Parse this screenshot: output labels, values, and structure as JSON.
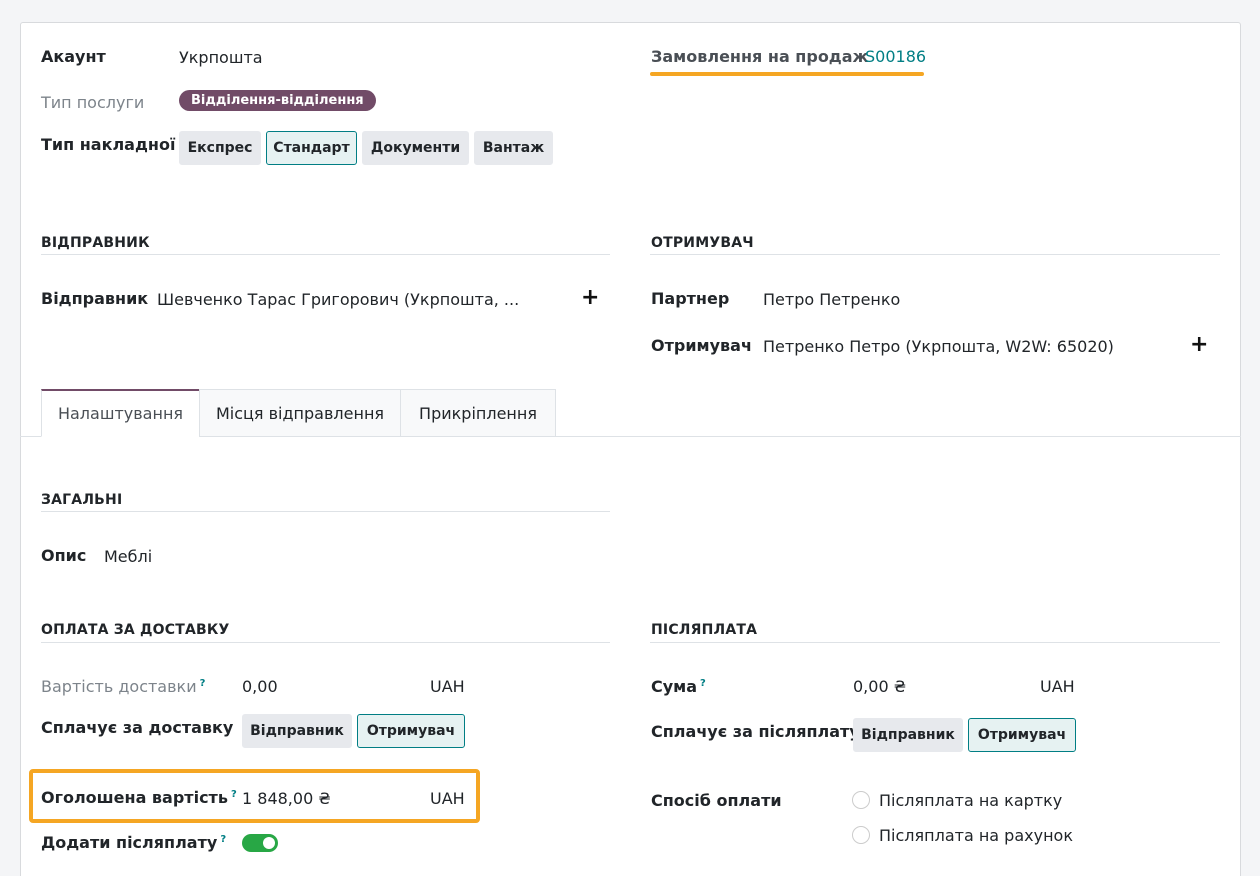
{
  "top": {
    "account_label": "Акаунт",
    "account_value": "Укрпошта",
    "service_type_label": "Тип послуги",
    "service_type_value": "Відділення-відділення",
    "waybill_type_label": "Тип накладної",
    "waybill_types": [
      "Експрес",
      "Стандарт",
      "Документи",
      "Вантаж"
    ],
    "waybill_type_selected": "Стандарт",
    "sale_order_label": "Замовлення на продаж",
    "sale_order_value": "S00186"
  },
  "sender_section": {
    "title": "ВІДПРАВНИК",
    "sender_label": "Відправник",
    "sender_value": "Шевченко Тарас Григорович (Укрпошта, ..."
  },
  "recipient_section": {
    "title": "ОТРИМУВАЧ",
    "partner_label": "Партнер",
    "partner_value": "Петро Петренко",
    "recipient_label": "Отримувач",
    "recipient_value": "Петренко Петро (Укрпошта, W2W: 65020)"
  },
  "tabs": [
    "Налаштування",
    "Місця відправлення",
    "Прикріплення"
  ],
  "active_tab": "Налаштування",
  "general": {
    "title": "ЗАГАЛЬНІ",
    "description_label": "Опис",
    "description_value": "Меблі"
  },
  "delivery_payment": {
    "title": "ОПЛАТА ЗА ДОСТАВКУ",
    "cost_label": "Вартість доставки",
    "cost_value": "0,00",
    "cost_currency": "UAH",
    "payer_label": "Сплачує за доставку",
    "payer_options": [
      "Відправник",
      "Отримувач"
    ],
    "payer_selected": "Отримувач",
    "declared_label": "Оголошена вартість",
    "declared_value": "1 848,00 ₴",
    "declared_currency": "UAH",
    "add_cod_label": "Додати післяплату",
    "add_cod_on": true
  },
  "cod": {
    "title": "ПІСЛЯПЛАТА",
    "sum_label": "Сума",
    "sum_value": "0,00 ₴",
    "sum_currency": "UAH",
    "payer_label": "Сплачує за післяплату",
    "payer_options": [
      "Відправник",
      "Отримувач"
    ],
    "payer_selected": "Отримувач",
    "method_label": "Спосіб оплати",
    "method_options": [
      "Післяплата на картку",
      "Післяплата на рахунок"
    ]
  },
  "help_mark": "?",
  "plus_glyph": "+",
  "colors": {
    "accent": "#017e84",
    "brand": "#714b67",
    "highlight": "#f5a623",
    "toggle_on": "#28a745"
  }
}
